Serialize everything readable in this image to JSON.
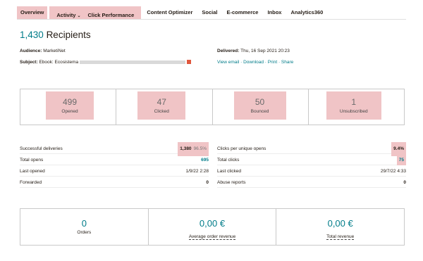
{
  "tabs": {
    "overview": "Overview",
    "activity": "Activity",
    "activity_chevron": "⌄",
    "click_performance": "Click Performance",
    "content_optimizer": "Content Optimizer",
    "social": "Social",
    "ecommerce": "E-commerce",
    "inbox": "Inbox",
    "analytics360": "Analytics360"
  },
  "header": {
    "recipients_count": "1,430",
    "recipients_label": "Recipients"
  },
  "meta": {
    "audience_label": "Audience:",
    "audience_value": "MarketiNet",
    "subject_label": "Subject:",
    "subject_value": "Ebook: Ecosistema",
    "delivered_label": "Delivered:",
    "delivered_value": "Thu, 16 Sep 2021 20:23",
    "links": "View email · Download · Print · Share"
  },
  "stats": [
    {
      "value": "499",
      "label": "Opened"
    },
    {
      "value": "47",
      "label": "Clicked"
    },
    {
      "value": "50",
      "label": "Bounced"
    },
    {
      "value": "1",
      "label": "Unsubscribed"
    }
  ],
  "left_kv": [
    {
      "label": "Successful deliveries",
      "value": "1,380",
      "extra": "96.5%"
    },
    {
      "label": "Total opens",
      "value": "695"
    },
    {
      "label": "Last opened",
      "value": "1/9/22 2:28"
    },
    {
      "label": "Forwarded",
      "value": "0"
    }
  ],
  "right_kv": [
    {
      "label": "Clicks per unique opens",
      "value": "9.4%"
    },
    {
      "label": "Total clicks",
      "value": "75"
    },
    {
      "label": "Last clicked",
      "value": "29/7/22 4:33"
    },
    {
      "label": "Abuse reports",
      "value": "0"
    }
  ],
  "revenue": [
    {
      "value": "0",
      "label": "Orders"
    },
    {
      "value": "0,00 €",
      "label": "Average order revenue"
    },
    {
      "value": "0,00 €",
      "label": "Total revenue"
    }
  ],
  "colors": {
    "teal": "#007c89",
    "highlight": "#f0c4c6"
  }
}
